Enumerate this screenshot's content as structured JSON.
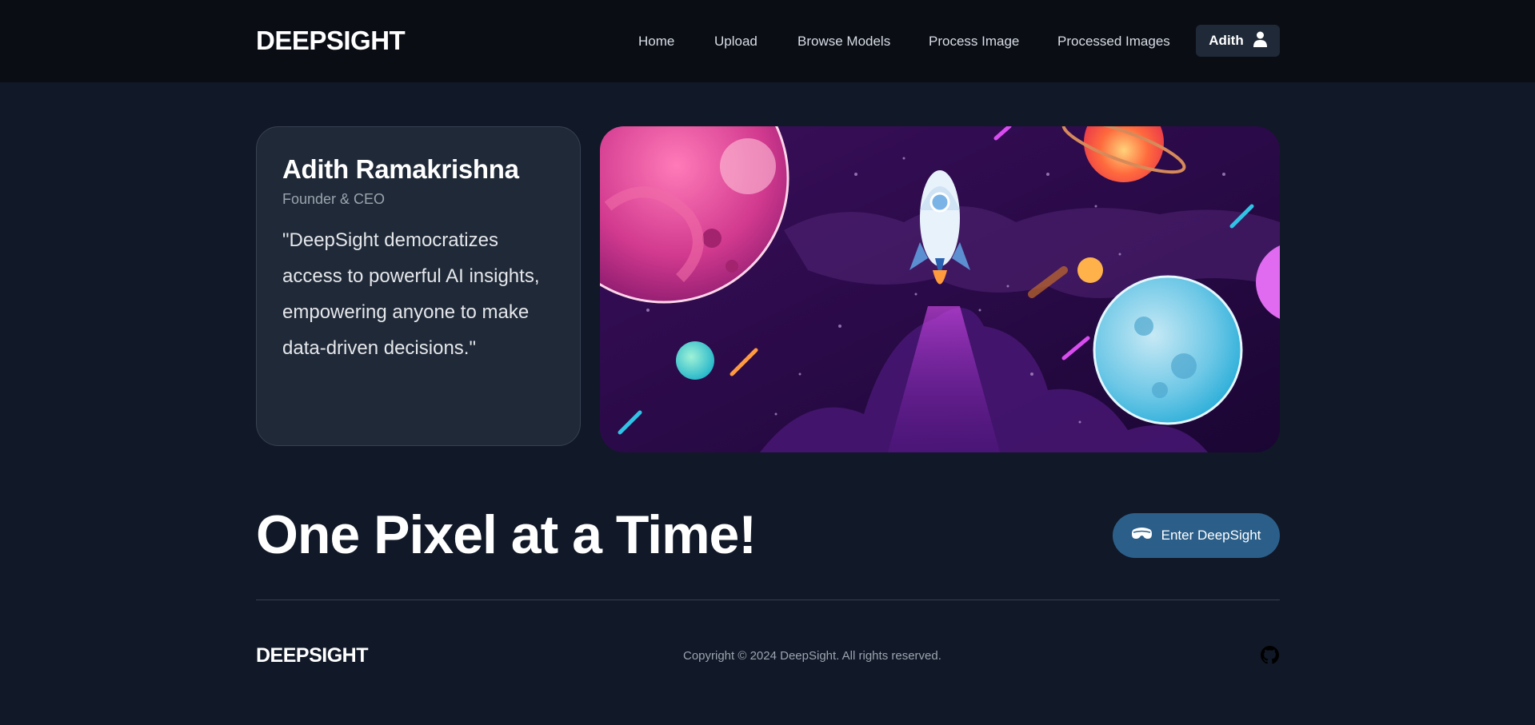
{
  "header": {
    "brand": "DEEPSIGHT",
    "nav": [
      "Home",
      "Upload",
      "Browse Models",
      "Process Image",
      "Processed Images"
    ],
    "user_label": "Adith",
    "user_icon": "user-icon"
  },
  "testimonial": {
    "name": "Adith Ramakrishna",
    "role": "Founder & CEO",
    "quote": "\"DeepSight democratizes access to powerful AI insights, empowering anyone to make data-driven decisions.\""
  },
  "hero": {
    "tagline": "One Pixel at a Time!",
    "cta_label": "Enter DeepSight",
    "cta_icon": "vr-headset-icon"
  },
  "footer": {
    "brand": "DEEPSIGHT",
    "copyright": "Copyright © 2024 DeepSight. All rights reserved.",
    "social_icon": "github-icon"
  },
  "colors": {
    "background": "#111827",
    "navbar": "#0a0d14",
    "card": "#1f2937",
    "cta": "#2b5f8a"
  }
}
